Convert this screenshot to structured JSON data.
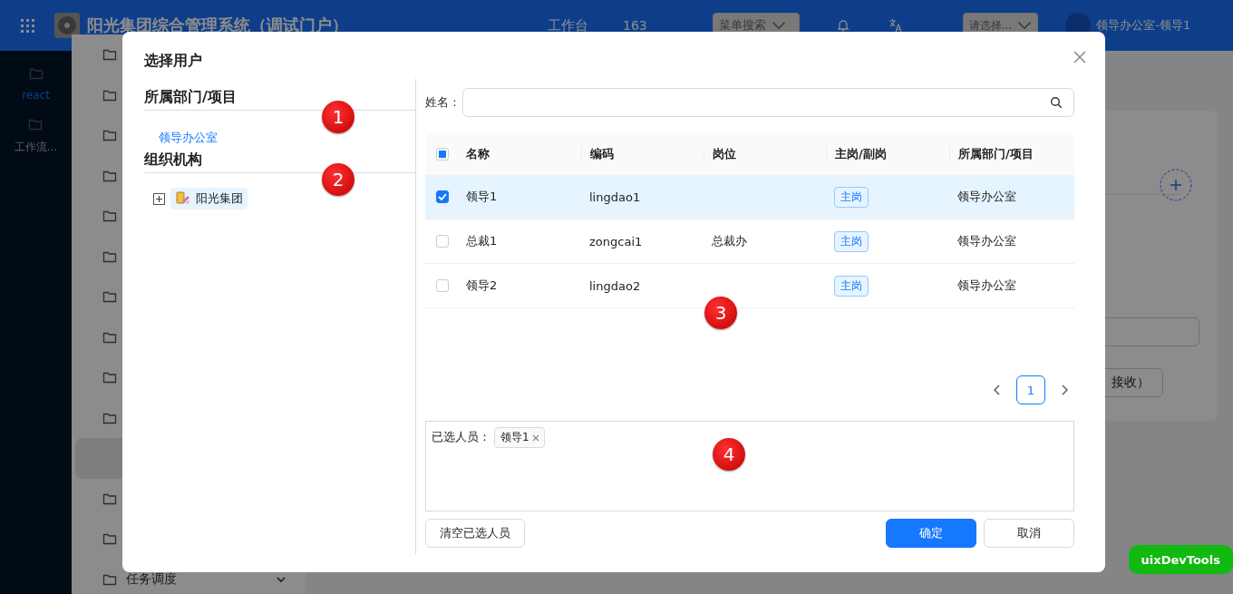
{
  "header": {
    "title": "阳光集团综合管理系统（调试门户）",
    "workbench": "工作台",
    "count": "163",
    "menu_search": "菜单搜索",
    "select_placeholder": "请选择...",
    "user": "领导办公室-领导1"
  },
  "sidebar": {
    "items": [
      {
        "label": "react",
        "selected": true
      },
      {
        "label": "工作流...",
        "selected": false
      }
    ]
  },
  "menu": {
    "items": [
      {
        "selected": false
      },
      {
        "selected": false
      },
      {
        "selected": false
      },
      {
        "selected": false
      },
      {
        "selected": false
      },
      {
        "selected": false
      },
      {
        "selected": false
      },
      {
        "selected": false
      },
      {
        "selected": false
      },
      {
        "selected": false
      },
      {
        "selected": true
      },
      {
        "selected": false
      },
      {
        "selected": false
      },
      {
        "label": "任务调度",
        "selected": false,
        "expanded": false
      }
    ]
  },
  "content": {
    "partial_button": "接收）"
  },
  "dialog": {
    "title": "选择用户",
    "left_sections": [
      {
        "heading": "所属部门/项目",
        "kind": "list",
        "items": [
          {
            "label": "领导办公室"
          }
        ],
        "marker": "1"
      },
      {
        "heading": "组织机构",
        "kind": "tree",
        "items": [
          {
            "label": "阳光集团",
            "expanded": false,
            "selected": true
          }
        ],
        "marker": "2"
      }
    ],
    "search": {
      "label": "姓名 :"
    },
    "table": {
      "header_checkbox": {
        "checked": false,
        "indeterminate": true
      },
      "columns": [
        "名称",
        "编码",
        "岗位",
        "主岗/副岗",
        "所属部门/项目"
      ],
      "rows": [
        {
          "selected": true,
          "name": "领导1",
          "code": "lingdao1",
          "post_type": "主岗",
          "dept": "领导办公室"
        },
        {
          "selected": false,
          "name": "总裁1",
          "code": "zongcai1",
          "post": "总裁办",
          "post_type": "主岗",
          "dept": "领导办公室"
        },
        {
          "selected": false,
          "name": "领导2",
          "code": "lingdao2",
          "post_type": "主岗",
          "dept": "领导办公室"
        }
      ],
      "marker": "3"
    },
    "pagination": {
      "pages": [
        {
          "label": "1",
          "selected": true
        }
      ]
    },
    "selected_box": {
      "label": "已选人员：",
      "tags": [
        "领导1"
      ],
      "marker": "4"
    },
    "buttons": {
      "clear": "清空已选人员",
      "ok": "确定",
      "cancel": "取消"
    }
  },
  "devtools": "uixDevTools"
}
